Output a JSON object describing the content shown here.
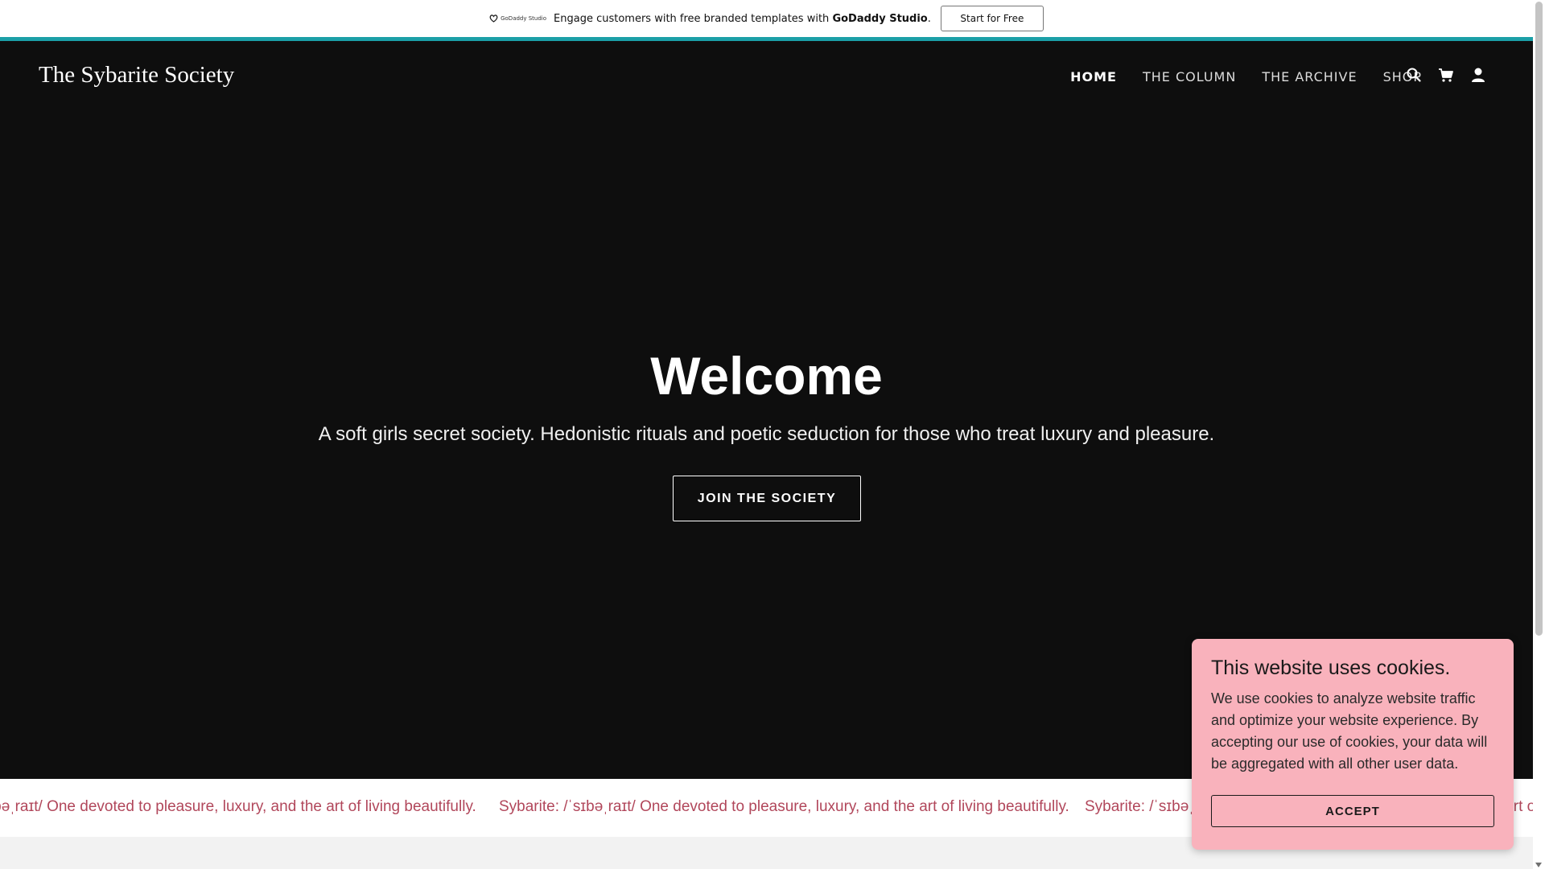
{
  "promo": {
    "logo_text": "GoDaddy Studio",
    "text_prefix": "Engage customers with free branded templates with ",
    "text_brand": "GoDaddy Studio",
    "text_suffix": ".",
    "button_label": "Start for Free",
    "accent_color": "#1b9fa7"
  },
  "header": {
    "site_title": "The Sybarite Society",
    "nav": [
      {
        "label": "HOME",
        "active": true
      },
      {
        "label": "THE COLUMN",
        "active": false
      },
      {
        "label": "THE ARCHIVE",
        "active": false
      },
      {
        "label": "SHOP",
        "active": false
      }
    ],
    "icons": [
      "search-icon",
      "cart-icon",
      "account-icon"
    ]
  },
  "hero": {
    "heading": "Welcome",
    "tagline": "A soft girls secret society. Hedonistic rituals and poetic seduction for those who treat luxury and pleasure.",
    "cta_label": "JOIN THE SOCIETY",
    "background_color": "#0e0e0e"
  },
  "marquee": {
    "items": [
      "Sybarite: /ˈsɪbəˌraɪt/ One devoted to pleasure, luxury, and the art of living beautifully.",
      "Sybarite: /ˈsɪbəˌraɪt/ One devoted to pleasure, luxury, and the art of living beautifully.",
      "Sybarite: /ˈsɪbəˌraɪt/ One devoted to pleasure, luxury, and the art of living beautifully."
    ],
    "text_color": "#b1475b"
  },
  "cookie": {
    "title": "This website uses cookies.",
    "body": "We use cookies to analyze website traffic and optimize your website experience. By accepting our use of cookies, your data will be aggregated with all other user data.",
    "accept_label": "ACCEPT",
    "background_color": "#f9b2bc"
  }
}
